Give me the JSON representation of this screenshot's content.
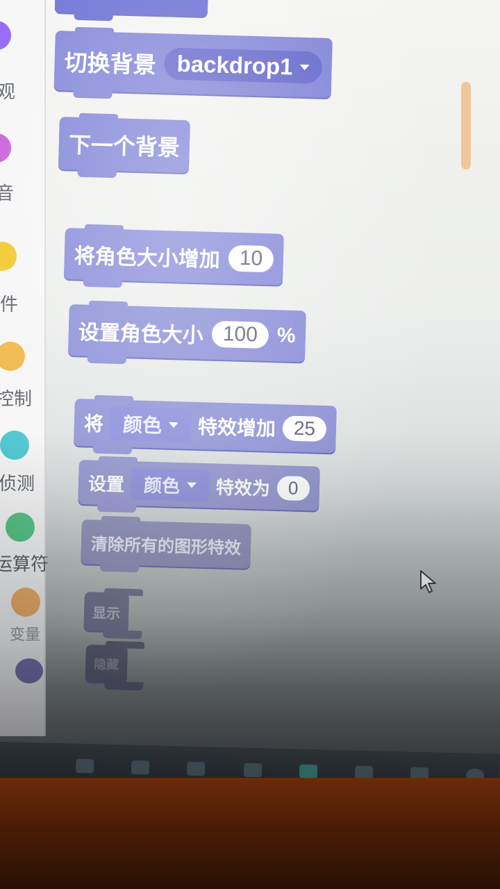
{
  "categories": [
    {
      "label": "观",
      "color": "#8b5cf6"
    },
    {
      "label": "音",
      "color": "#c757d8"
    },
    {
      "label": "件",
      "color": "#f2c521"
    },
    {
      "label": "控制",
      "color": "#f0b441"
    },
    {
      "label": "侦测",
      "color": "#45c4d0"
    },
    {
      "label": "运算符",
      "color": "#4ec27f"
    },
    {
      "label": "变量",
      "color": "#f2a24e"
    },
    {
      "label": "",
      "color": "#5a4f9e"
    }
  ],
  "blocks": {
    "switch_backdrop": {
      "label": "切换背景",
      "value": "backdrop1"
    },
    "next_backdrop": {
      "label": "下一个背景"
    },
    "change_size": {
      "label": "将角色大小增加",
      "value": "10"
    },
    "set_size": {
      "label": "设置角色大小",
      "value": "100",
      "suffix": "%"
    },
    "change_effect": {
      "prefix": "将",
      "effect": "颜色",
      "label": "特效增加",
      "value": "25"
    },
    "set_effect": {
      "prefix": "设置",
      "effect": "颜色",
      "label": "特效为",
      "value": "0"
    },
    "clear_effects": {
      "label": "清除所有的图形特效"
    },
    "show": {
      "label": "显示"
    },
    "hide": {
      "label": "隐藏"
    }
  }
}
